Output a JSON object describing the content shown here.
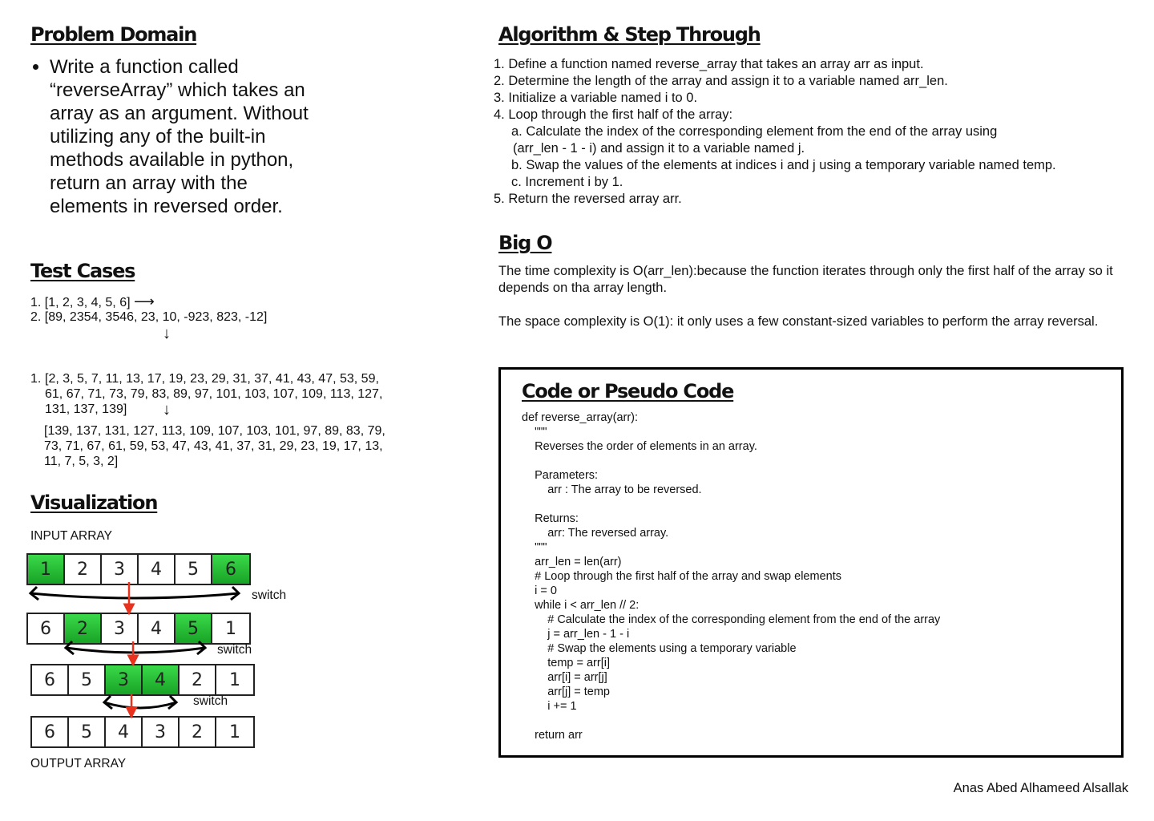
{
  "problem_domain": {
    "title": "Problem Domain",
    "bullet": "Write a function called “reverseArray” which takes an array as an argument. Without utilizing any of the built-in methods available in python, return an array with the elements in reversed order."
  },
  "test_cases": {
    "title": "Test Cases",
    "group1": [
      {
        "num": "1.",
        "text": "[1, 2, 3, 4, 5, 6]",
        "arrow": "⟶"
      },
      {
        "num": "2.",
        "text": "[89, 2354, 3546, 23, 10, -923, 823, -12]"
      }
    ],
    "down_arrow": "↓",
    "group2_num": "1.",
    "group2_input": [
      "[2, 3, 5, 7, 11, 13, 17, 19, 23, 29, 31, 37, 41, 43, 47, 53, 59,",
      "61, 67, 71, 73, 79, 83, 89, 97, 101, 103, 107, 109, 113, 127,",
      "131, 137, 139]"
    ],
    "group2_output": [
      "[139, 137, 131, 127, 113, 109, 107, 103, 101, 97, 89, 83, 79,",
      "73, 71, 67, 61, 59, 53, 47, 43, 41, 37, 31, 29, 23, 19, 17, 13,",
      "11, 7, 5, 3, 2]"
    ]
  },
  "visualization": {
    "title": "Visualization",
    "input_label": "INPUT ARRAY",
    "output_label": "OUTPUT ARRAY",
    "switch_label": "switch",
    "rows": [
      {
        "cells": [
          "1",
          "2",
          "3",
          "4",
          "5",
          "6"
        ],
        "highlight": [
          0,
          5
        ]
      },
      {
        "cells": [
          "6",
          "2",
          "3",
          "4",
          "5",
          "1"
        ],
        "highlight": [
          1,
          4
        ]
      },
      {
        "cells": [
          "6",
          "5",
          "3",
          "4",
          "2",
          "1"
        ],
        "highlight": [
          2,
          3
        ]
      },
      {
        "cells": [
          "6",
          "5",
          "4",
          "3",
          "2",
          "1"
        ],
        "highlight": []
      }
    ],
    "highlight_color": "#22b530",
    "arrow_color": "#e8321e"
  },
  "algorithm": {
    "title": "Algorithm & Step Through",
    "lines": [
      {
        "text": "1. Define a function named reverse_array that takes an array arr as input.",
        "indent": 0
      },
      {
        "text": "2. Determine the length of the array and assign it to a variable named arr_len.",
        "indent": 0
      },
      {
        "text": "3. Initialize a variable named i to 0.",
        "indent": 0
      },
      {
        "text": "4. Loop through the first half of the array:",
        "indent": 0
      },
      {
        "text": "a. Calculate the index of the corresponding element from the end of the array using",
        "indent": 1
      },
      {
        "text": "(arr_len - 1 - i) and assign it to a variable named j.",
        "indent": 1
      },
      {
        "text": "b. Swap the values of the elements at indices i and j using a temporary variable named temp.",
        "indent": 1
      },
      {
        "text": "c. Increment i by 1.",
        "indent": 1
      },
      {
        "text": "5. Return the reversed array arr.",
        "indent": 0
      }
    ]
  },
  "big_o": {
    "title": "Big O",
    "time": "The time complexity is O(arr_len):because the function iterates through only the first half of the array so it depends on tha array length.",
    "space": "The space complexity is O(1): it only uses a few constant-sized variables to perform the array reversal."
  },
  "code": {
    "title": "Code or Pseudo Code",
    "text": "def reverse_array(arr):\n    \"\"\"\n    Reverses the order of elements in an array.\n\n    Parameters:\n        arr : The array to be reversed.\n\n    Returns:\n        arr: The reversed array.\n    \"\"\"\n    arr_len = len(arr)\n    # Loop through the first half of the array and swap elements\n    i = 0\n    while i < arr_len // 2:\n        # Calculate the index of the corresponding element from the end of the array\n        j = arr_len - 1 - i\n        # Swap the elements using a temporary variable\n        temp = arr[i]\n        arr[i] = arr[j]\n        arr[j] = temp\n        i += 1\n\n    return arr"
  },
  "author": "Anas Abed Alhameed Alsallak"
}
